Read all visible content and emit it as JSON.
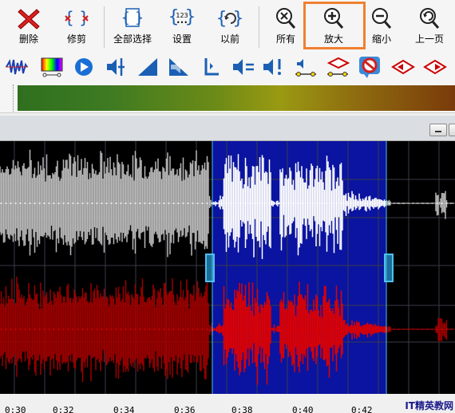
{
  "toolbar": {
    "row1": [
      {
        "key": "delete",
        "label": "删除"
      },
      {
        "key": "trim",
        "label": "修剪"
      },
      {
        "key": "select_all",
        "label": "全部选择"
      },
      {
        "key": "settings",
        "label": "设置"
      },
      {
        "key": "previous",
        "label": "以前"
      },
      {
        "key": "all",
        "label": "所有"
      },
      {
        "key": "zoom_in",
        "label": "放大"
      },
      {
        "key": "zoom_out",
        "label": "缩小"
      },
      {
        "key": "prev_page",
        "label": "上一页"
      }
    ],
    "settings_icon_text": "123",
    "highlighted": "zoom_in",
    "highlight_color": "#f08030"
  },
  "waveform": {
    "selection_color": "#0a14a0",
    "channel_top_color": "#b8b8b8",
    "channel_bottom_color": "#e00000"
  },
  "ruler": {
    "ticks": [
      "0:30",
      "0:32",
      "0:34",
      "0:36",
      "0:38",
      "0:40",
      "0:42"
    ]
  },
  "watermark": "IT精英教网"
}
